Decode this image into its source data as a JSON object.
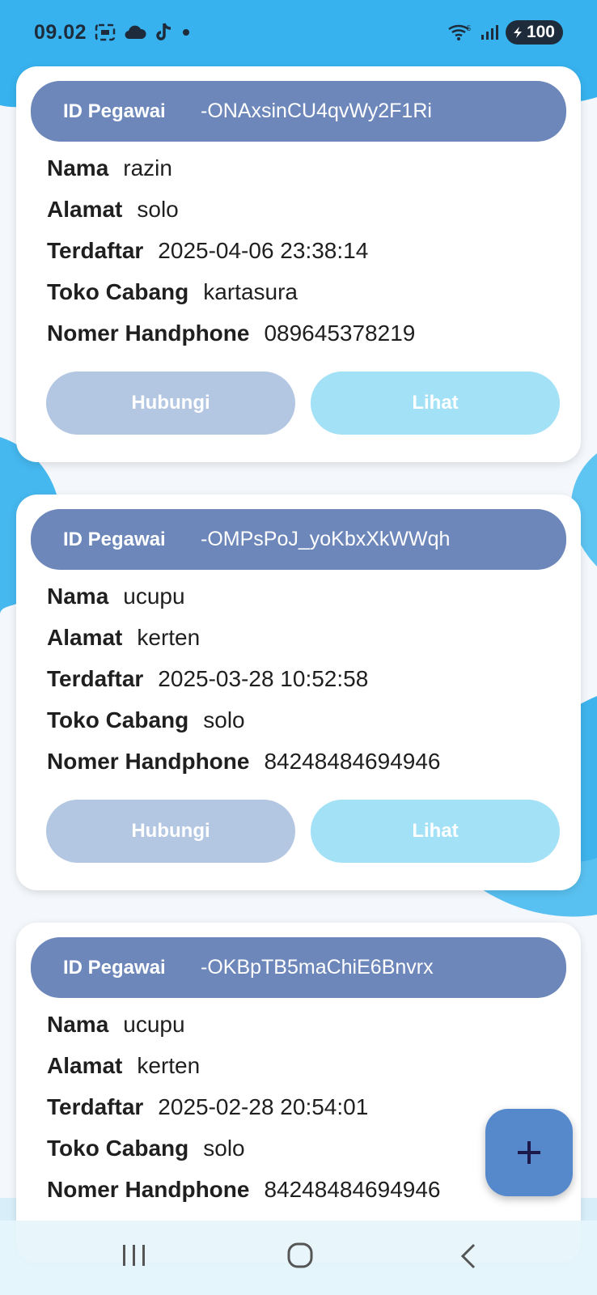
{
  "status_bar": {
    "time": "09.02",
    "battery": "100",
    "icons": [
      "screenshot-icon",
      "cloud-icon",
      "tiktok-icon",
      "dot-icon",
      "wifi-icon",
      "signal-icon",
      "battery-icon"
    ]
  },
  "cards": [
    {
      "id_label": "ID Pegawai",
      "id_value": "-ONAxsinCU4qvWy2F1Ri",
      "fields": [
        {
          "label": "Nama",
          "value": "razin"
        },
        {
          "label": "Alamat",
          "value": "solo"
        },
        {
          "label": "Terdaftar",
          "value": "2025-04-06 23:38:14"
        },
        {
          "label": "Toko Cabang",
          "value": "kartasura"
        },
        {
          "label": "Nomer Handphone",
          "value": "089645378219"
        }
      ],
      "btn_contact": "Hubungi",
      "btn_view": "Lihat"
    },
    {
      "id_label": "ID Pegawai",
      "id_value": "-OMPsPoJ_yoKbxXkWWqh",
      "fields": [
        {
          "label": "Nama",
          "value": "ucupu"
        },
        {
          "label": "Alamat",
          "value": "kerten"
        },
        {
          "label": "Terdaftar",
          "value": "2025-03-28 10:52:58"
        },
        {
          "label": "Toko Cabang",
          "value": "solo"
        },
        {
          "label": "Nomer Handphone",
          "value": "84248484694946"
        }
      ],
      "btn_contact": "Hubungi",
      "btn_view": "Lihat"
    },
    {
      "id_label": "ID Pegawai",
      "id_value": "-OKBpTB5maChiE6Bnvrx",
      "fields": [
        {
          "label": "Nama",
          "value": "ucupu"
        },
        {
          "label": "Alamat",
          "value": "kerten"
        },
        {
          "label": "Terdaftar",
          "value": "2025-02-28 20:54:01"
        },
        {
          "label": "Toko Cabang",
          "value": "solo"
        },
        {
          "label": "Nomer Handphone",
          "value": "84248484694946"
        }
      ]
    }
  ],
  "fab": {
    "icon": "plus-icon"
  },
  "nav_bar": {
    "icons": [
      "recent-apps-icon",
      "home-icon",
      "back-icon"
    ]
  },
  "colors": {
    "card_header": "#6d87ba",
    "button_contact": "#b3c6e2",
    "button_view": "#a3e1f7",
    "fab": "#5589cc",
    "background_accent": "#45b8ef"
  }
}
